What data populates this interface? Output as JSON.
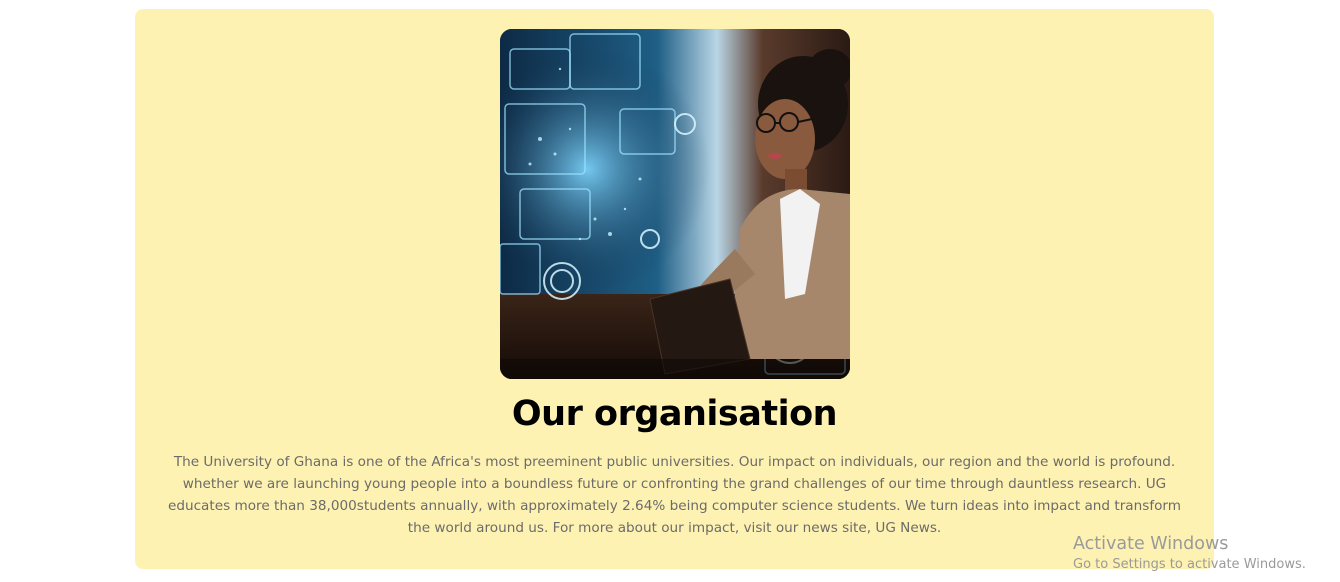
{
  "section": {
    "title": "Our organisation",
    "description": "The University of Ghana is one of the Africa's most preeminent public universities. Our impact on individuals, our region and the world is profound. whether we are launching young people into a boundless future or confronting the grand challenges of our time through dauntless research. UG educates more than 38,000students annually, with approximately 2.64% being computer science students. We turn ideas into impact and transform the world around us. For more about our impact, visit our news site, UG News.",
    "background_color": "#fef2b2"
  },
  "watermark": {
    "title": "Activate Windows",
    "subtitle": "Go to Settings to activate Windows."
  }
}
